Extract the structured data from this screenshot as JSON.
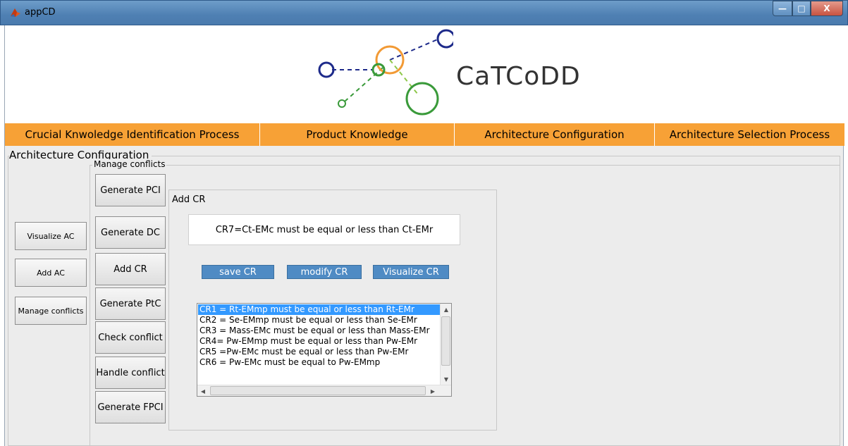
{
  "window": {
    "title": "appCD",
    "controls": {
      "minimize": "—",
      "maximize": "□",
      "close": "X"
    }
  },
  "logo": {
    "text": "CaTCoDD",
    "colors": {
      "navy": "#1d2a8a",
      "green": "#3a9a3a",
      "orange": "#f29a35",
      "lightgreen": "#8ec84a"
    }
  },
  "menu": [
    {
      "label": "Crucial Knwoledge Identification Process"
    },
    {
      "label": "Product Knowledge"
    },
    {
      "label": "Architecture Configuration"
    },
    {
      "label": "Architecture Selection Process"
    }
  ],
  "section": {
    "title": "Architecture Configuration"
  },
  "left_buttons": [
    {
      "label": "Visualize AC"
    },
    {
      "label": "Add AC"
    },
    {
      "label": "Manage conflicts"
    }
  ],
  "manage_conflicts": {
    "title": "Manage conflicts",
    "buttons": [
      {
        "label": "Generate PCI"
      },
      {
        "label": "Generate DC"
      },
      {
        "label": "Add CR"
      },
      {
        "label": "Generate PtC"
      },
      {
        "label": "Check conflict"
      },
      {
        "label": "Handle conflict"
      },
      {
        "label": "Generate FPCI"
      }
    ]
  },
  "add_cr": {
    "title": "Add CR",
    "current_value": "CR7=Ct-EMc must be equal or less than Ct-EMr",
    "buttons": {
      "save": "save CR",
      "modify": "modify CR",
      "visualize": "Visualize CR"
    },
    "list": [
      "CR1 = Rt-EMmp must be equal or less than Rt-EMr",
      "CR2 = Se-EMmp must be equal or less than Se-EMr",
      "CR3 = Mass-EMc must be equal or less than Mass-EMr",
      "CR4= Pw-EMmp must be equal or less than Pw-EMr",
      "CR5 =Pw-EMc must be equal or less than Pw-EMr",
      "CR6 = Pw-EMc must be equal to Pw-EMmp"
    ],
    "selected_index": 0
  }
}
